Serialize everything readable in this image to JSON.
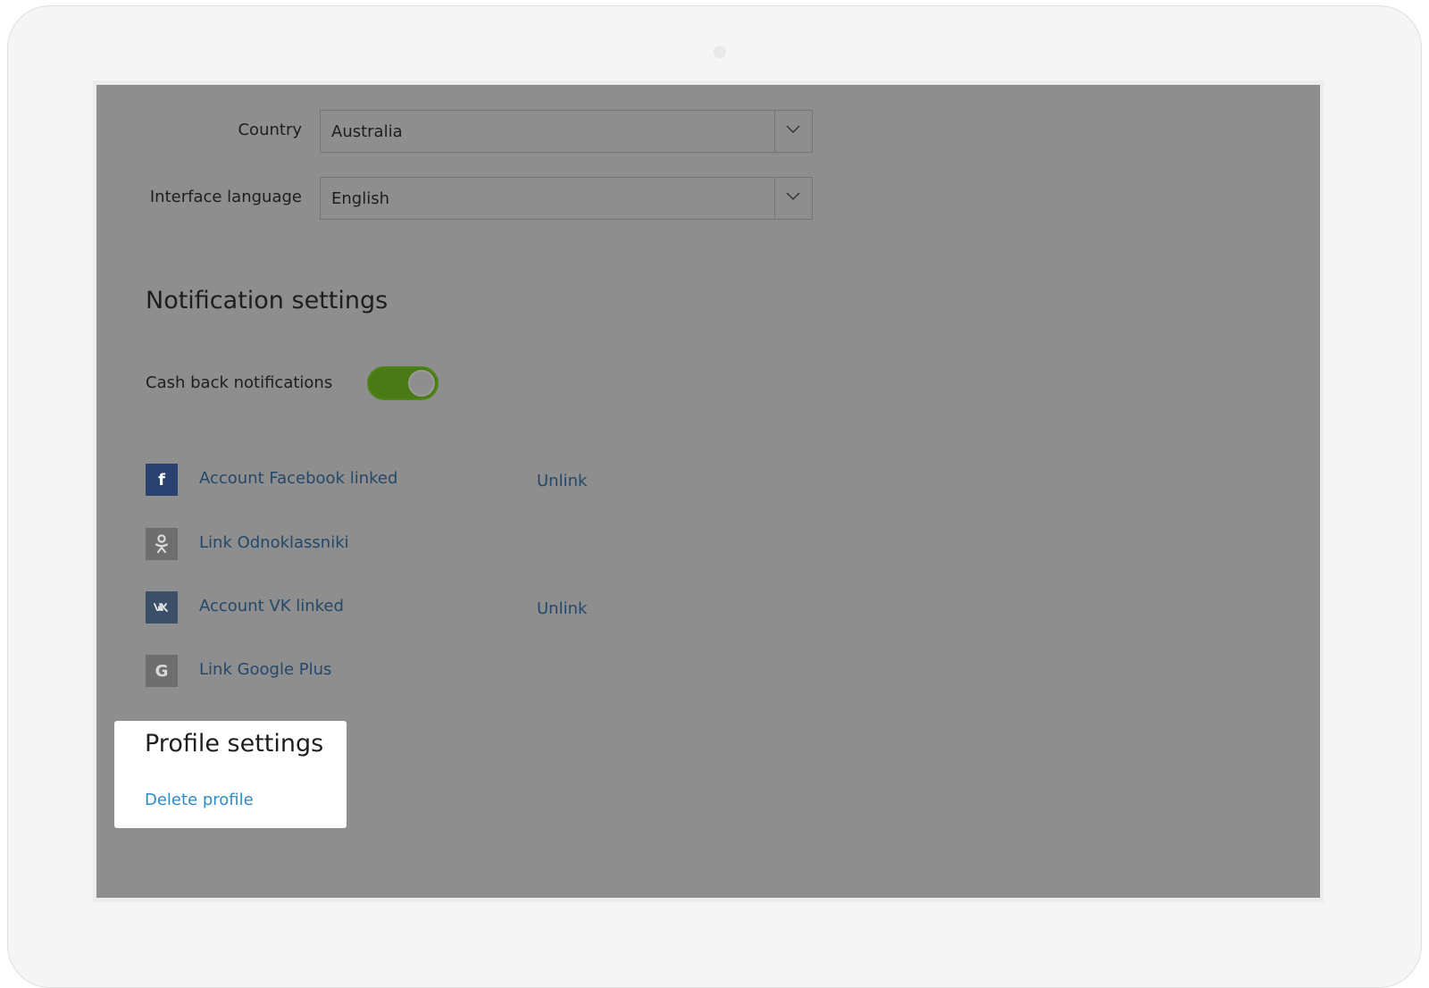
{
  "settings": {
    "country": {
      "label": "Country",
      "value": "Australia"
    },
    "language": {
      "label": "Interface language",
      "value": "English"
    }
  },
  "notifications": {
    "title": "Notification settings",
    "cashback": {
      "label": "Cash back notifications",
      "enabled": true
    }
  },
  "social": {
    "facebook": {
      "icon": "facebook-icon",
      "glyph": "f",
      "color": "#2b4170",
      "label": "Account Facebook linked",
      "action": "Unlink"
    },
    "odnoklassniki": {
      "icon": "odnoklassniki-icon",
      "color": "#6e6e6e",
      "label": "Link Odnoklassniki"
    },
    "vk": {
      "icon": "vk-icon",
      "color": "#3b5068",
      "label": "Account VK linked",
      "action": "Unlink"
    },
    "google": {
      "icon": "google-plus-icon",
      "glyph": "G",
      "color": "#6e6e6e",
      "label": "Link Google Plus"
    }
  },
  "profile": {
    "title": "Profile settings",
    "delete_label": "Delete profile"
  },
  "colors": {
    "overlay": "#8e8e8e",
    "link": "#24486a",
    "toggle_on": "#4a7a16",
    "highlight_link": "#2e8bc9"
  }
}
